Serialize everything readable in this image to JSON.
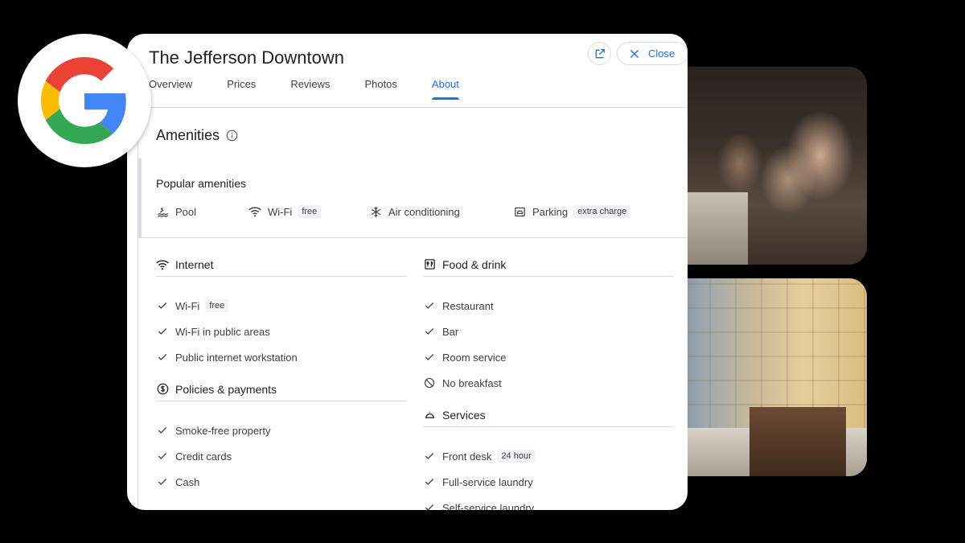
{
  "hotel": {
    "name": "The Jefferson Downtown"
  },
  "header": {
    "close_label": "Close"
  },
  "tabs": [
    {
      "label": "Overview"
    },
    {
      "label": "Prices"
    },
    {
      "label": "Reviews"
    },
    {
      "label": "Photos"
    },
    {
      "label": "About",
      "active": true
    }
  ],
  "amenities": {
    "title": "Amenities",
    "popular": {
      "title": "Popular amenities",
      "items": [
        {
          "label": "Pool",
          "icon": "pool-icon"
        },
        {
          "label": "Wi-Fi",
          "badge": "free",
          "icon": "wifi-icon"
        },
        {
          "label": "Air conditioning",
          "icon": "snowflake-icon"
        },
        {
          "label": "Parking",
          "badge": "extra charge",
          "icon": "parking-icon"
        }
      ]
    },
    "sections": {
      "internet": {
        "title": "Internet",
        "icon": "wifi-icon",
        "items": [
          {
            "label": "Wi-Fi",
            "badge": "free",
            "icon": "check-icon"
          },
          {
            "label": "Wi-Fi in public areas",
            "icon": "check-icon"
          },
          {
            "label": "Public internet workstation",
            "icon": "check-icon"
          }
        ]
      },
      "policies": {
        "title": "Policies & payments",
        "icon": "dollar-icon",
        "items": [
          {
            "label": "Smoke-free property",
            "icon": "check-icon"
          },
          {
            "label": "Credit cards",
            "icon": "check-icon"
          },
          {
            "label": "Cash",
            "icon": "check-icon"
          }
        ]
      },
      "food": {
        "title": "Food & drink",
        "icon": "restaurant-icon",
        "items": [
          {
            "label": "Restaurant",
            "icon": "check-icon"
          },
          {
            "label": "Bar",
            "icon": "check-icon"
          },
          {
            "label": "Room service",
            "icon": "check-icon"
          },
          {
            "label": "No breakfast",
            "icon": "not-available-icon"
          }
        ]
      },
      "services": {
        "title": "Services",
        "icon": "bell-icon",
        "items": [
          {
            "label": "Front desk",
            "badge": "24 hour",
            "icon": "check-icon"
          },
          {
            "label": "Full-service laundry",
            "icon": "check-icon"
          },
          {
            "label": "Self-service laundry",
            "icon": "check-icon"
          }
        ]
      }
    }
  },
  "colors": {
    "accent": "#1a73e8",
    "text": "#202124",
    "divider": "#dadce0"
  }
}
